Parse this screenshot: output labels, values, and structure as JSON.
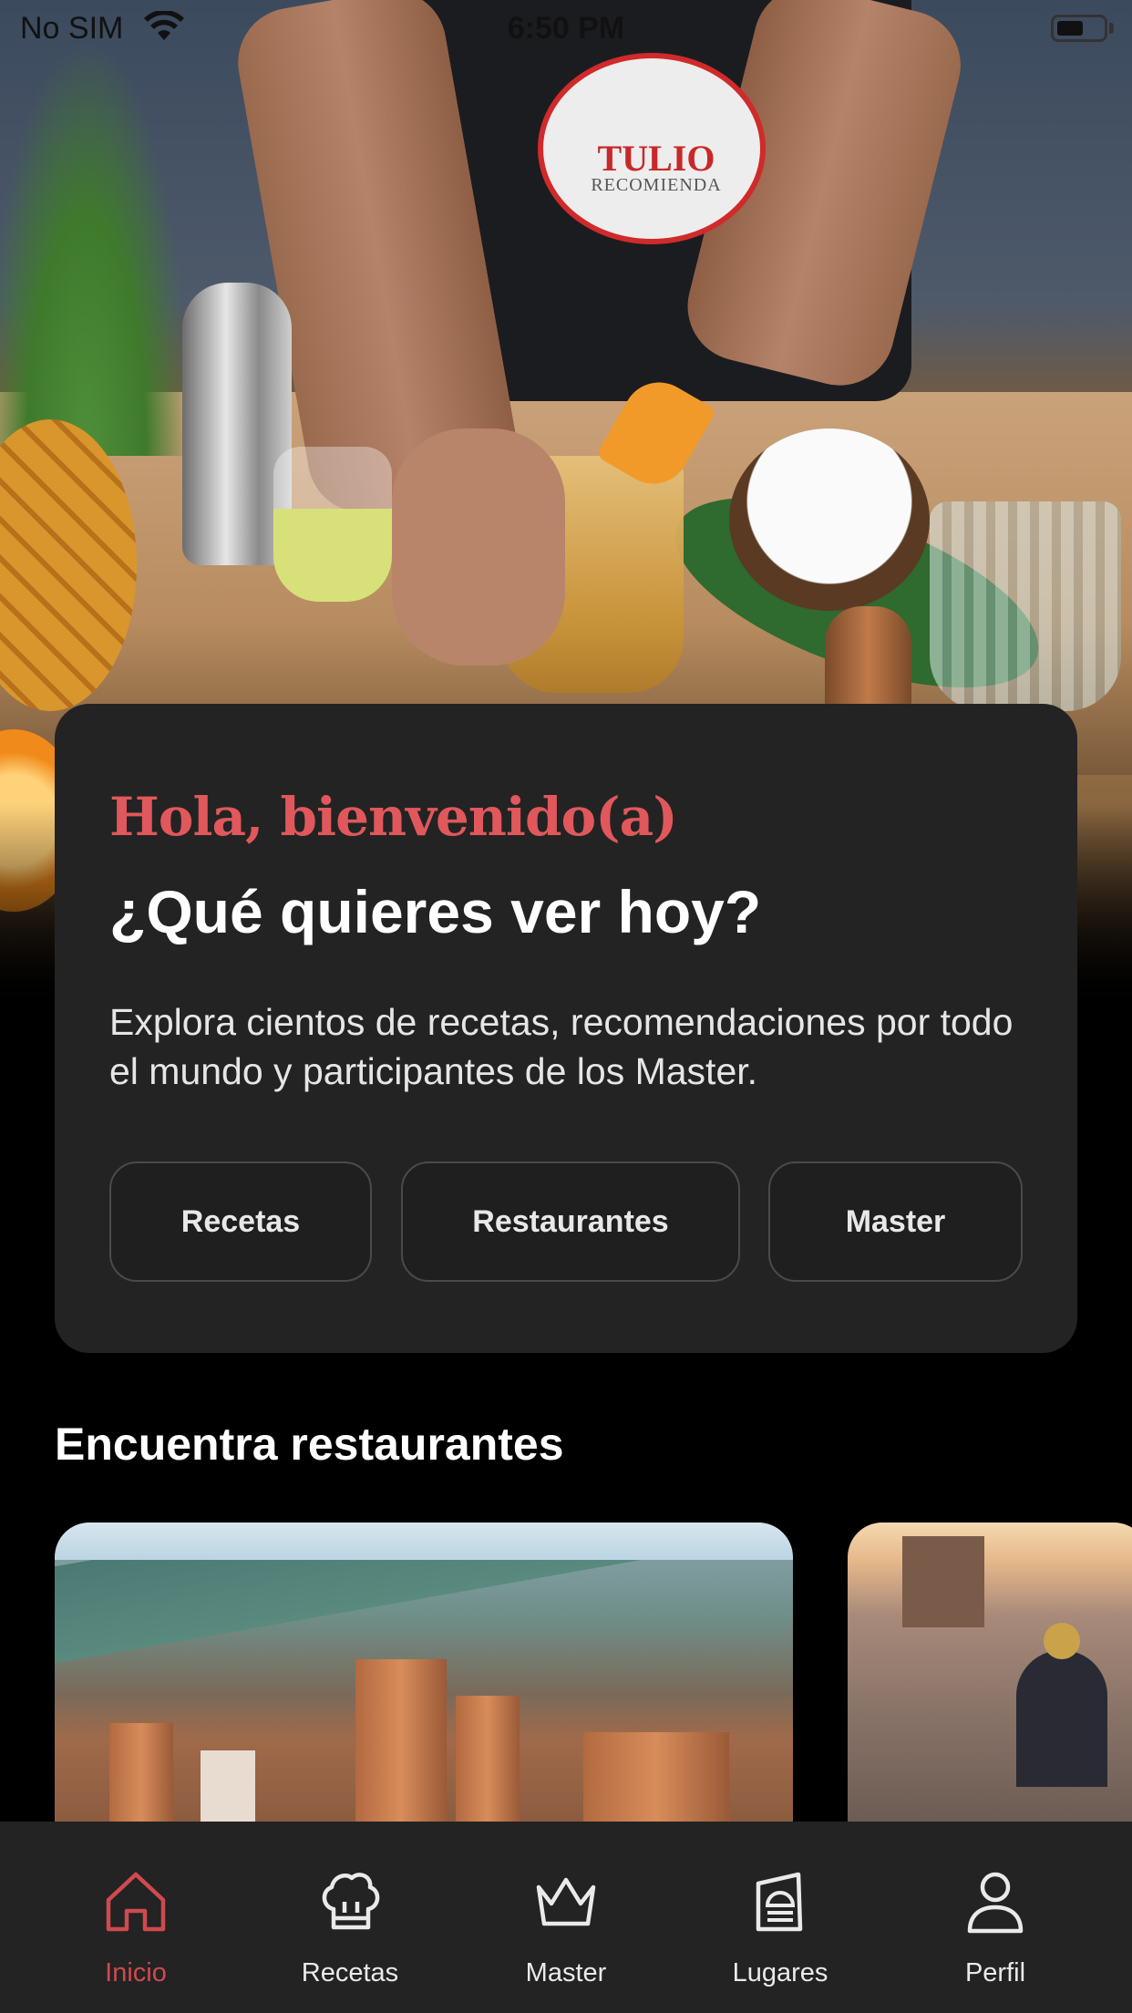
{
  "status_bar": {
    "carrier": "No SIM",
    "time": "6:50 PM"
  },
  "hero": {
    "logo_text": "TULIO",
    "logo_subtext": "RECOMIENDA"
  },
  "welcome": {
    "greeting": "Hola, bienvenido(a)",
    "title": "¿Qué quieres ver hoy?",
    "description": "Explora cientos de recetas, recomendaciones por todo el mundo y participantes de los Master.",
    "buttons": [
      "Recetas",
      "Restaurantes",
      "Master"
    ]
  },
  "restaurants": {
    "section_title": "Encuentra restaurantes"
  },
  "tabbar": {
    "items": [
      {
        "label": "Inicio",
        "icon": "home-icon",
        "active": true
      },
      {
        "label": "Recetas",
        "icon": "chef-hat-icon",
        "active": false
      },
      {
        "label": "Master",
        "icon": "crown-icon",
        "active": false
      },
      {
        "label": "Lugares",
        "icon": "menu-book-icon",
        "active": false
      },
      {
        "label": "Perfil",
        "icon": "user-icon",
        "active": false
      }
    ]
  },
  "colors": {
    "accent": "#cf4a4e",
    "card": "#232323",
    "background": "#000000"
  }
}
